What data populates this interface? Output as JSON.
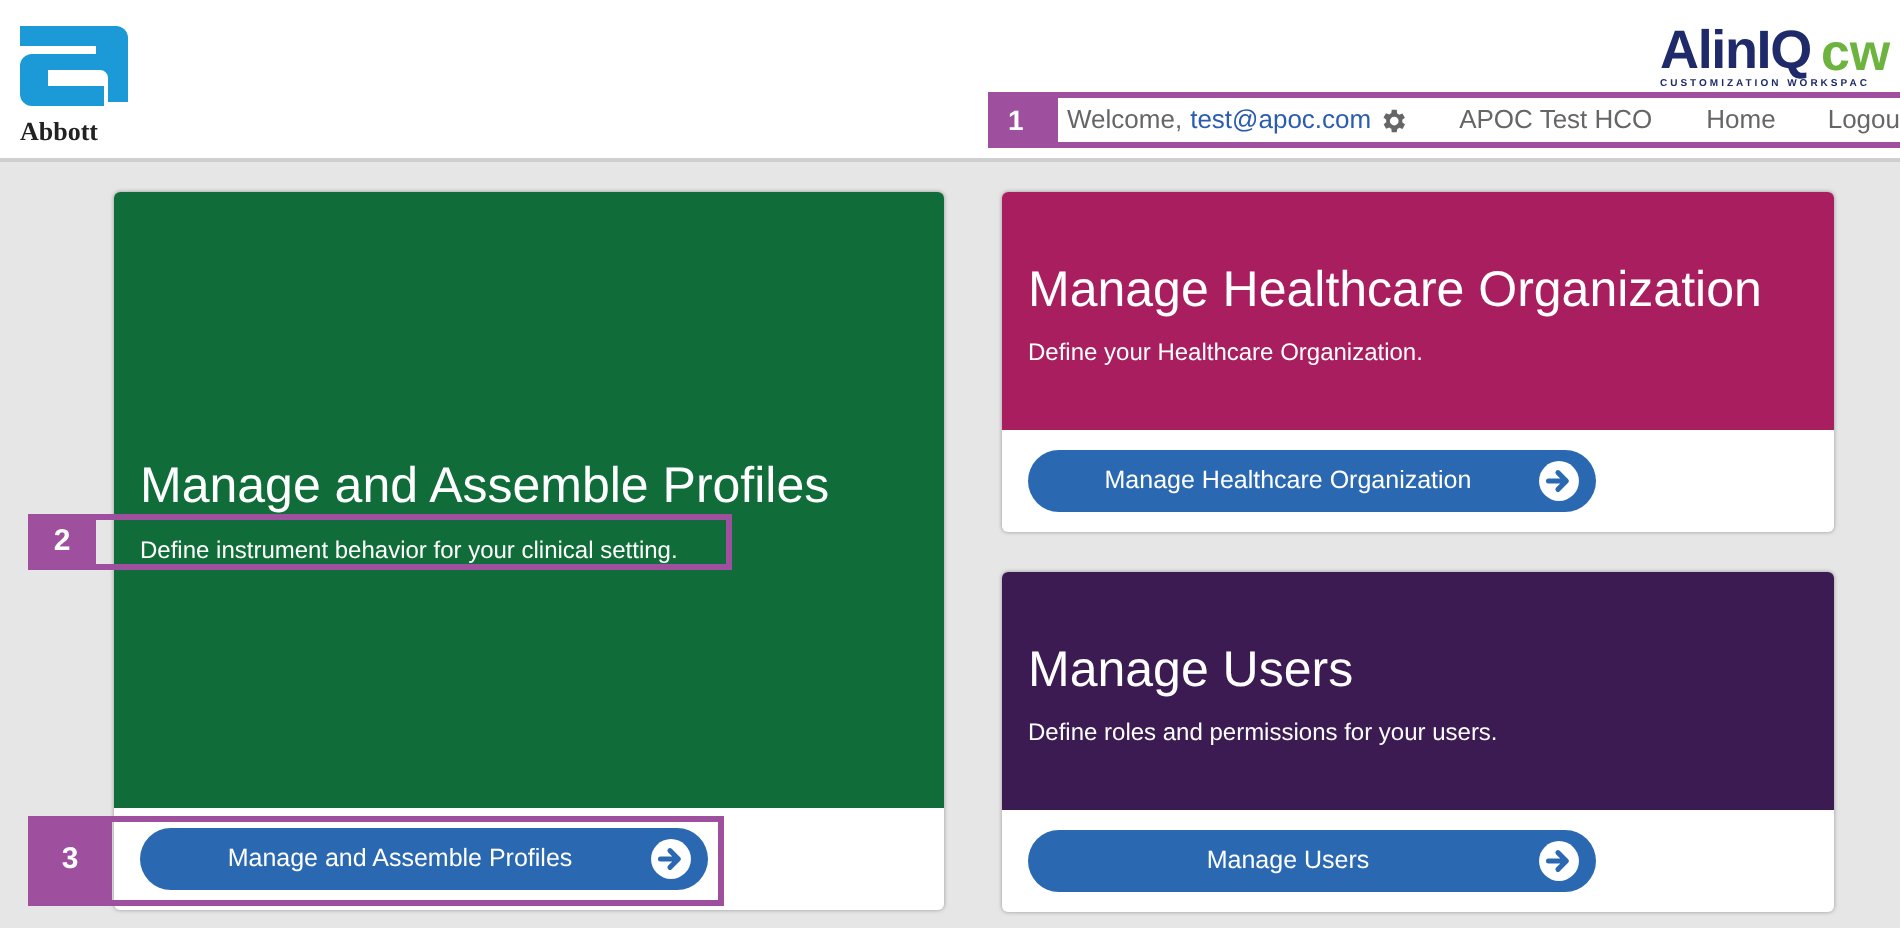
{
  "header": {
    "brand": "Abbott",
    "product_logo": {
      "name": "AlinIQ",
      "suffix": "cw",
      "tagline": "CUSTOMIZATION WORKSPAC"
    },
    "nav": {
      "welcome": "Welcome,",
      "user": "test@apoc.com",
      "organization": "APOC Test HCO",
      "links": [
        "Home",
        "Logou"
      ]
    }
  },
  "cards": [
    {
      "title": "Manage and Assemble Profiles",
      "description": "Define instrument behavior for your clinical setting.",
      "button": "Manage and Assemble Profiles",
      "color": "#106c39"
    },
    {
      "title": "Manage Healthcare Organization",
      "description": "Define your Healthcare Organization.",
      "button": "Manage Healthcare Organization",
      "color": "#a91e5f"
    },
    {
      "title": "Manage Users",
      "description": "Define roles and permissions for your users.",
      "button": "Manage Users",
      "color": "#3c1a52"
    }
  ],
  "callouts": [
    "1",
    "2",
    "3"
  ]
}
